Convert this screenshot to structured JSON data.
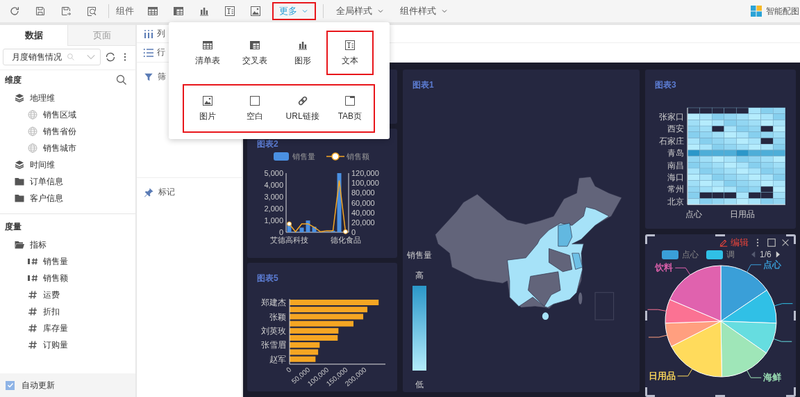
{
  "toolbar": {
    "component_label": "组件",
    "more_button": {
      "label": "更多",
      "selected": true,
      "highlighted": true
    },
    "style_menus": [
      {
        "label": "全局样式"
      },
      {
        "label": "组件样式"
      }
    ],
    "smart_chart": {
      "label": "智能配图"
    }
  },
  "component_menu": {
    "rows": [
      {
        "highlighted": false,
        "items": [
          {
            "label": "清单表",
            "kind": "list-table",
            "highlighted": false
          },
          {
            "label": "交叉表",
            "kind": "cross-table",
            "highlighted": false
          },
          {
            "label": "图形",
            "kind": "chart",
            "highlighted": false
          },
          {
            "label": "文本",
            "kind": "text",
            "highlighted": true
          }
        ]
      },
      {
        "highlighted": true,
        "items": [
          {
            "label": "图片",
            "kind": "image",
            "highlighted": false
          },
          {
            "label": "空白",
            "kind": "blank",
            "highlighted": false
          },
          {
            "label": "URL链接",
            "kind": "link",
            "highlighted": false
          },
          {
            "label": "TAB页",
            "kind": "tab",
            "highlighted": false
          }
        ]
      }
    ]
  },
  "data_panel": {
    "tabs": [
      {
        "label": "数据",
        "selected": true
      },
      {
        "label": "页面",
        "selected": false
      }
    ],
    "dataset_field": {
      "value": "月度销售情况"
    },
    "dimensions": {
      "title": "维度",
      "items": [
        {
          "label": "地理维",
          "kind": "dimension-group",
          "children": [
            {
              "label": "销售区域",
              "kind": "geo"
            },
            {
              "label": "销售省份",
              "kind": "geo"
            },
            {
              "label": "销售城市",
              "kind": "geo"
            }
          ]
        },
        {
          "label": "时间维",
          "kind": "dimension-group"
        },
        {
          "label": "订单信息",
          "kind": "folder"
        },
        {
          "label": "客户信息",
          "kind": "folder"
        }
      ]
    },
    "measures": {
      "title": "度量",
      "items": [
        {
          "label": "指标",
          "kind": "open-folder",
          "children": [
            {
              "label": "销售量",
              "kind": "bar-measure"
            },
            {
              "label": "销售额",
              "kind": "bar-measure"
            },
            {
              "label": "运费",
              "kind": "measure"
            },
            {
              "label": "折扣",
              "kind": "measure"
            },
            {
              "label": "库存量",
              "kind": "measure"
            },
            {
              "label": "订购量",
              "kind": "measure"
            }
          ]
        }
      ]
    },
    "auto_update": {
      "label": "自动更新",
      "checked": true
    }
  },
  "shelves": {
    "columns": {
      "label": "列"
    },
    "rows": {
      "label": "行"
    },
    "filter": {
      "label": "筛"
    },
    "marks": {
      "label": "标记"
    }
  },
  "chart_1": {
    "title": "图表1",
    "legend": {
      "title": "销售量",
      "high": "高",
      "low": "低"
    }
  },
  "chart_2": {
    "title": "图表2",
    "chart_data": {
      "type": "bar",
      "legend": "top",
      "categories": [
        "艾德高科技",
        null,
        null,
        null,
        null,
        null,
        null,
        null,
        null,
        "德化食品"
      ],
      "ylim": [
        0,
        5000
      ],
      "yticks": [
        0,
        {
          "value": 1000,
          "label": "1,000"
        },
        {
          "value": 2000,
          "label": "2,000"
        },
        {
          "value": 3000,
          "label": "3,000"
        },
        {
          "value": 4000,
          "label": "4,000"
        },
        {
          "value": 5000,
          "label": "5,000"
        }
      ],
      "series": [
        {
          "name": "销售量",
          "color": "#4a90e2",
          "values": [
            680,
            60,
            390,
            990,
            460,
            null,
            30,
            130,
            5000,
            null
          ]
        }
      ]
    },
    "line_chart": {
      "chart_data": {
        "type": "line",
        "legend": "top",
        "categories": [
          null,
          null,
          null,
          null,
          null,
          null,
          null,
          null,
          null,
          null
        ],
        "ylim": [
          0,
          120000
        ],
        "yticks": [
          0,
          {
            "value": 20000,
            "label": "20,000"
          },
          {
            "value": 40000,
            "label": "40,000"
          },
          {
            "value": 60000,
            "label": "60,000"
          },
          {
            "value": 80000,
            "label": "80,000"
          },
          {
            "value": 100000,
            "label": "100,000"
          },
          {
            "value": 120000,
            "label": "120,000"
          }
        ],
        "series": [
          {
            "name": "销售额",
            "color": "#f5a623",
            "values": [
              17000,
              1000,
              17000,
              17000,
              10000,
              1000,
              3000,
              3000,
              105000,
              1000
            ]
          }
        ]
      }
    }
  },
  "chart_3": {
    "title": "图表3",
    "row_labels": [
      "张家口",
      "西安",
      "石家庄",
      "青岛",
      "南昌",
      "海口",
      "常州",
      "北京"
    ],
    "column_labels": [
      "点心",
      "日用品"
    ]
  },
  "chart_5": {
    "title": "图表5",
    "chart_data": {
      "type": "bar",
      "orientation": "horizontal",
      "categories": [
        "郑建杰",
        null,
        "张颖",
        null,
        "刘英玫",
        null,
        "张雪眉",
        null,
        "赵军"
      ],
      "xlim": [
        0,
        255000
      ],
      "xticks": [
        0,
        {
          "value": 50000,
          "label": "50,000"
        },
        {
          "value": 100000,
          "label": "100,000"
        },
        {
          "value": 150000,
          "label": "150,000"
        },
        {
          "value": 200000,
          "label": "200,000"
        }
      ],
      "series": [
        {
          "color": "#f5a623",
          "values": [
            237000,
            207000,
            196000,
            170000,
            130000,
            128000,
            80000,
            76000,
            69000
          ]
        }
      ]
    }
  },
  "pie_card": {
    "edit_label": "编辑",
    "page": "1/6",
    "legend": [
      {
        "label": "点心",
        "color": "#3a9fd8"
      },
      {
        "label": "调",
        "color": "#30c0e6"
      }
    ],
    "slices": [
      {
        "color": "#3a9fd8"
      },
      {
        "color": "#30c0e6"
      },
      {
        "color": "#66dde0"
      },
      {
        "color": "#9fe6b8"
      },
      {
        "color": "#ffdb5c"
      },
      {
        "color": "#ff9f7f"
      },
      {
        "color": "#fb7293"
      },
      {
        "color": "#e062ae"
      }
    ],
    "slice_labels": [
      {
        "label": "饮料",
        "color": "#e062ae"
      },
      {
        "label": "点心",
        "color": "#3a9fd8"
      },
      {
        "label": "日用品",
        "color": "#ffdb5c"
      },
      {
        "label": "海鲜",
        "color": "#9fe6b8"
      }
    ]
  }
}
